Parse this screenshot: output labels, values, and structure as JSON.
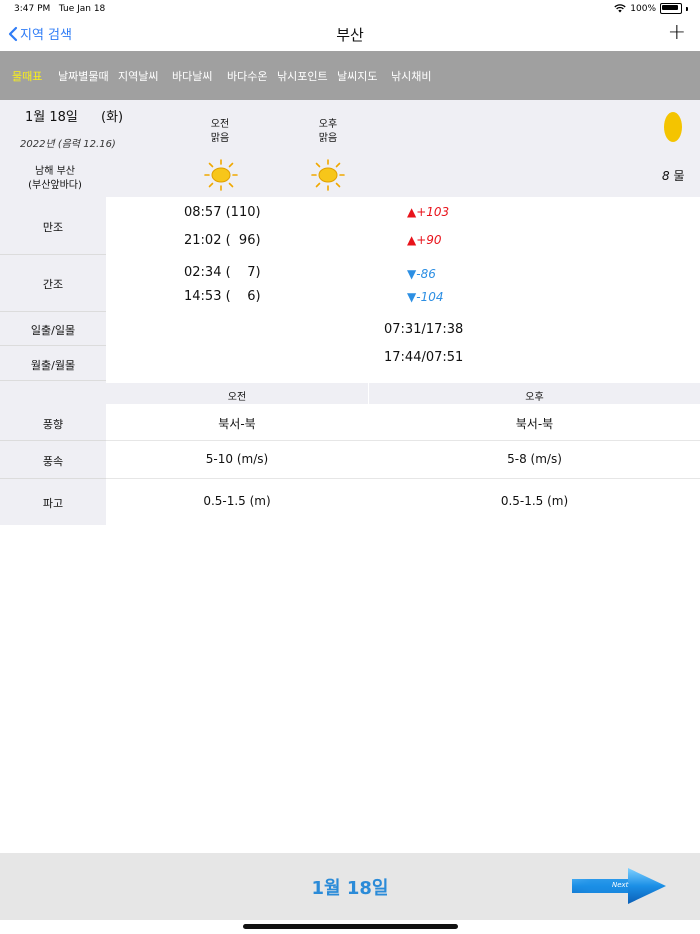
{
  "status": {
    "time": "3:47 PM",
    "date": "Tue Jan 18",
    "battery": "100%"
  },
  "nav": {
    "back_label": "지역 검색",
    "title": "부산",
    "add_label": "+"
  },
  "tabs": [
    "물때표",
    "날짜별물때",
    "지역날씨",
    "바다날씨",
    "바다수온",
    "낚시포인트",
    "날씨지도",
    "낚시채비"
  ],
  "header": {
    "date": "1월 18일",
    "weekday": "(화)",
    "lunar": "2022년 (음력 12.16)",
    "am_label": "오전",
    "am_weather": "맑음",
    "pm_label": "오후",
    "pm_weather": "맑음",
    "region": "남해 부산",
    "region_sub": "(부산앞바다)",
    "tide_num": "8",
    "tide_unit": "물"
  },
  "tide": {
    "high_label": "만조",
    "high": [
      {
        "time": "08:57 (110)",
        "diff": "+103"
      },
      {
        "time": "21:02 (  96)",
        "diff": "+90"
      }
    ],
    "low_label": "간조",
    "low": [
      {
        "time": "02:34 (    7)",
        "diff": "-86"
      },
      {
        "time": "14:53 (    6)",
        "diff": "-104"
      }
    ],
    "sun_label": "일출/일몰",
    "sun": "07:31/17:38",
    "moon_label": "월출/월몰",
    "moon": "17:44/07:51"
  },
  "weather": {
    "am_header": "오전",
    "pm_header": "오후",
    "rows": [
      {
        "label": "풍향",
        "am": "북서-북",
        "pm": "북서-북"
      },
      {
        "label": "풍속",
        "am": "5-10 (m/s)",
        "pm": "5-8 (m/s)"
      },
      {
        "label": "파고",
        "am": "0.5-1.5 (m)",
        "pm": "0.5-1.5 (m)"
      }
    ]
  },
  "footer": {
    "date": "1월 18일",
    "next_label": "Next"
  },
  "colors": {
    "accent": "#2f7cf6",
    "tab_bg": "#a0a0a0",
    "tab_active": "#f9f01a",
    "up": "#e8131b",
    "down": "#2d8fe3"
  }
}
